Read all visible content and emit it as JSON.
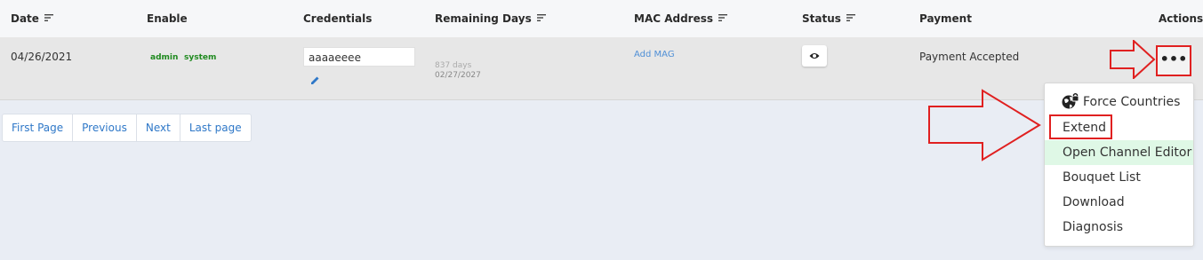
{
  "table": {
    "columns": [
      {
        "label": "Date",
        "sortable": true
      },
      {
        "label": "Enable",
        "sortable": false
      },
      {
        "label": "Credentials",
        "sortable": false
      },
      {
        "label": "Remaining Days",
        "sortable": true
      },
      {
        "label": "MAC Address",
        "sortable": true
      },
      {
        "label": "Status",
        "sortable": true
      },
      {
        "label": "Payment",
        "sortable": false
      },
      {
        "label": "Actions",
        "sortable": false
      }
    ],
    "rows": [
      {
        "date": "04/26/2021",
        "enable_tags": [
          "admin",
          "system"
        ],
        "credentials": "aaaaeeee",
        "remaining_days": "837 days",
        "expiry_date": "02/27/2027",
        "mac_address": "Add MAG",
        "payment": "Payment Accepted",
        "actions_label": "•••"
      }
    ]
  },
  "pagination": [
    "First Page",
    "Previous",
    "Next",
    "Last page"
  ],
  "action_menu": {
    "items": [
      "Force Countries",
      "Extend",
      "Open Channel Editor",
      "Bouquet List",
      "Download",
      "Diagnosis"
    ],
    "highlighted": "Open Channel Editor",
    "outlined": "Extend"
  },
  "colors": {
    "accent_link": "#2f78c8",
    "tag_green": "#1f8a1f",
    "annotation_red": "#e02020",
    "menu_highlight": "#dff8e6"
  }
}
